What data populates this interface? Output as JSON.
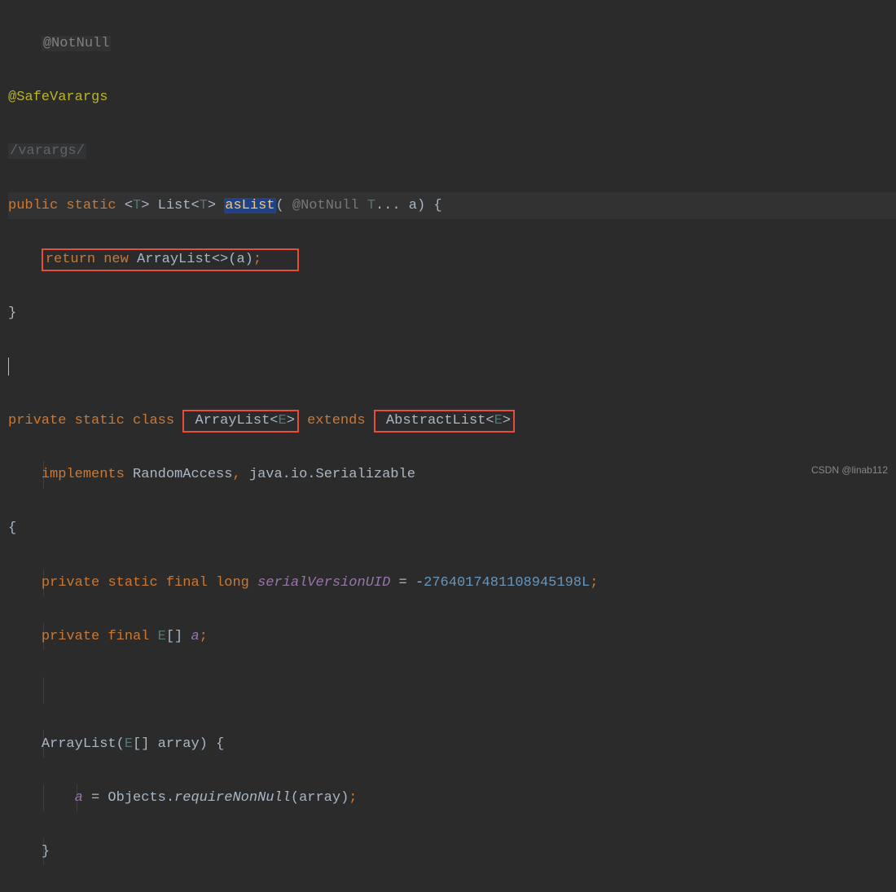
{
  "lines": {
    "l1_annotation": "@NotNull",
    "l2_annotation": "@SafeVarargs",
    "l3_hint": "/varargs/",
    "l4_public": "public",
    "l4_static": "static",
    "l4_open_angle": "<",
    "l4_T": "T",
    "l4_close_angle": ">",
    "l4_List": "List",
    "l4_open_angle2": "<",
    "l4_T2": "T",
    "l4_close_angle2": ">",
    "l4_asList": "asList",
    "l4_lparen": "(",
    "l4_param_anno": " @NotNull ",
    "l4_T3": "T",
    "l4_varargs": "...",
    "l4_a": " a",
    "l4_rparen_brace": ") {",
    "l5_return": "return",
    "l5_new": "new",
    "l5_ArrayList": " ArrayList<>(a)",
    "l5_semi": ";",
    "l6_brace": "}",
    "l8_private": "private",
    "l8_static": "static",
    "l8_class": "class",
    "l8_ArrayList": " ArrayList",
    "l8_open_angle": "<",
    "l8_E": "E",
    "l8_close_angle": ">",
    "l8_extends": "extends",
    "l8_AbstractList": " AbstractList",
    "l8_open_angle2": "<",
    "l8_E2": "E",
    "l8_close_angle2": ">",
    "l9_implements": "implements",
    "l9_RandomAccess": " RandomAccess",
    "l9_comma": ",",
    "l9_javaio": " java.io.Serializable",
    "l10_brace": "{",
    "l11_private": "private",
    "l11_static": "static",
    "l11_final": "final",
    "l11_long": "long",
    "l11_serialVersionUID": "serialVersionUID",
    "l11_eq": " = ",
    "l11_minus": "-",
    "l11_num": "2764017481108945198L",
    "l11_semi": ";",
    "l12_private": "private",
    "l12_final": "final",
    "l12_E": "E",
    "l12_brackets": "[] ",
    "l12_a": "a",
    "l12_semi": ";",
    "l14_ArrayList": "ArrayList",
    "l14_lparen": "(",
    "l14_E": "E",
    "l14_brackets": "[] array",
    "l14_rparen_brace": ") {",
    "l15_a": "a",
    "l15_eq": " = Objects.",
    "l15_requireNonNull": "requireNonNull",
    "l15_args": "(array)",
    "l15_semi": ";",
    "l16_brace": "}"
  },
  "watermark": "CSDN @linab112"
}
